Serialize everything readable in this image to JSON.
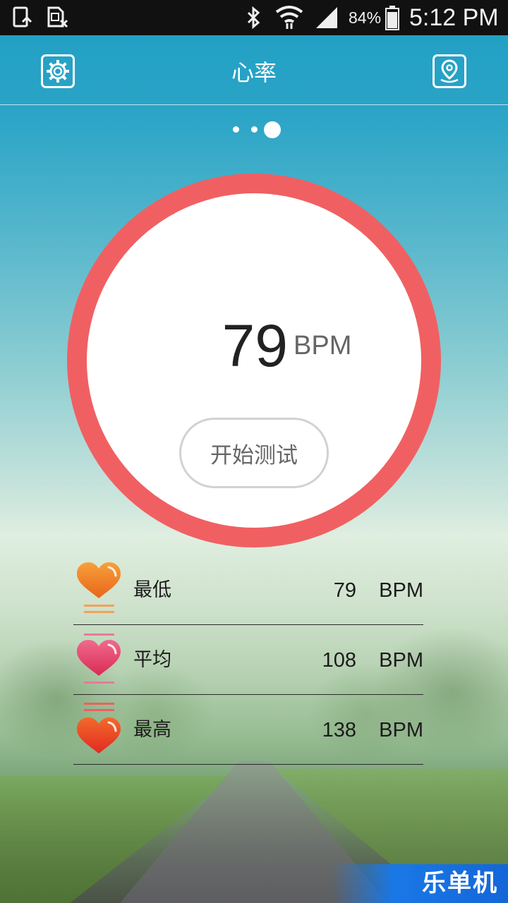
{
  "status_bar": {
    "battery": "84%",
    "time": "5:12 PM",
    "icons": [
      "screenshot-icon",
      "sim-card-icon",
      "bluetooth-icon",
      "wifi-icon",
      "signal-icon",
      "battery-icon"
    ]
  },
  "header": {
    "title": "心率",
    "left_icon": "settings-gear-icon",
    "right_icon": "location-pin-icon"
  },
  "pager": {
    "count": 3,
    "active_index": 2
  },
  "heart_rate": {
    "value": "79",
    "unit": "BPM",
    "start_button": "开始测试",
    "ring_color": "#f06062"
  },
  "stats": [
    {
      "label": "最低",
      "value": "79",
      "unit": "BPM",
      "icon": "heart-min-icon",
      "color": "#f07a23"
    },
    {
      "label": "平均",
      "value": "108",
      "unit": "BPM",
      "icon": "heart-avg-icon",
      "color": "#e8456e"
    },
    {
      "label": "最高",
      "value": "138",
      "unit": "BPM",
      "icon": "heart-max-icon",
      "color": "#e8352c"
    }
  ],
  "watermark": "乐单机"
}
